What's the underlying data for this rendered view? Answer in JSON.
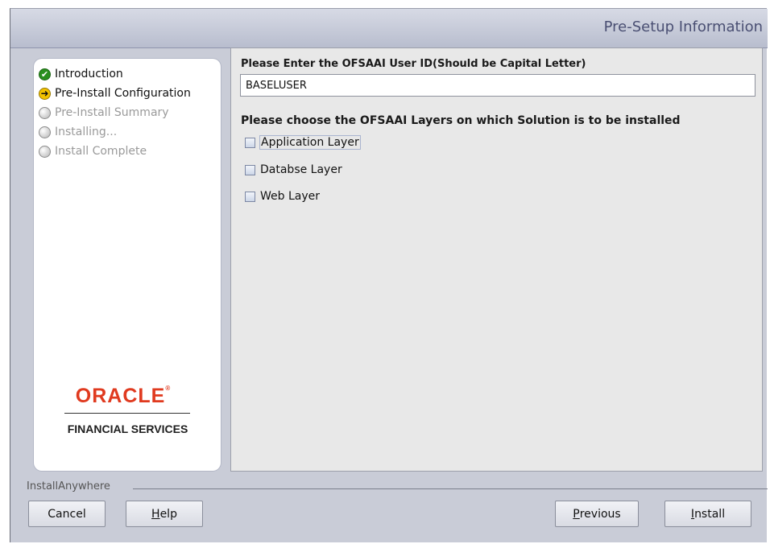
{
  "window": {
    "title": "Pre-Setup Information"
  },
  "steps": [
    {
      "label": "Introduction",
      "state": "done",
      "icon": "check-circle-icon"
    },
    {
      "label": "Pre-Install Configuration",
      "state": "current",
      "icon": "arrow-circle-icon"
    },
    {
      "label": "Pre-Install Summary",
      "state": "pending",
      "icon": "empty-circle-icon"
    },
    {
      "label": "Installing...",
      "state": "pending",
      "icon": "empty-circle-icon"
    },
    {
      "label": "Install Complete",
      "state": "pending",
      "icon": "empty-circle-icon"
    }
  ],
  "logo": {
    "brand": "ORACLE",
    "subtitle": "FINANCIAL SERVICES"
  },
  "form": {
    "userid_label": "Please Enter the OFSAAI User ID(Should be Capital Letter)",
    "userid_value": "BASELUSER",
    "layers_label": "Please choose the OFSAAI Layers on which Solution is to be installed",
    "layers": [
      {
        "label": "Application Layer",
        "checked": false
      },
      {
        "label": "Databse Layer",
        "checked": false
      },
      {
        "label": "Web Layer",
        "checked": false
      }
    ]
  },
  "footer": {
    "brand": "InstallAnywhere",
    "cancel_label": "Cancel",
    "help_label": "Help",
    "previous_label": "Previous",
    "install_label": "Install"
  },
  "colors": {
    "background": "#c9ccd7",
    "oracle_red": "#e03a1f",
    "done_green": "#2a8f1e",
    "current_yellow": "#f2c200"
  }
}
